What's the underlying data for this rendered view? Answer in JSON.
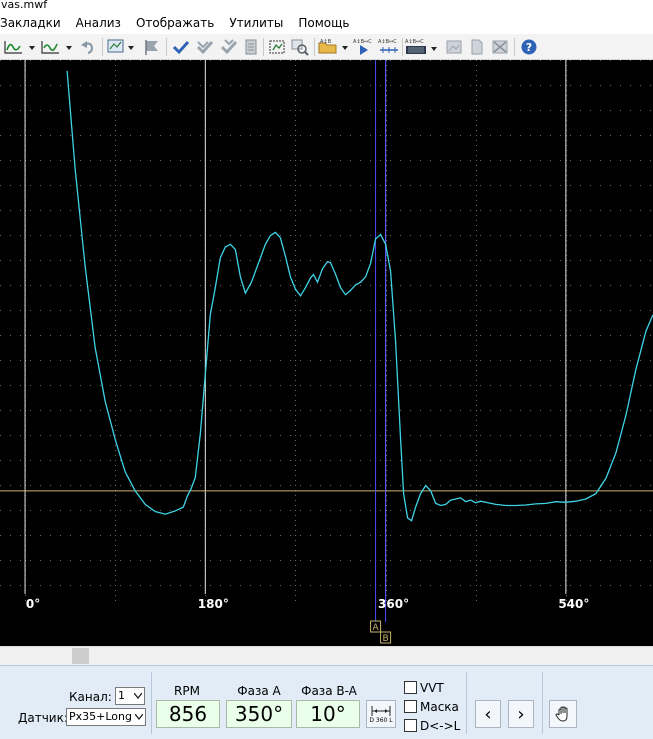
{
  "window": {
    "title": "vas.mwf"
  },
  "menu": [
    "Закладки",
    "Анализ",
    "Отображать",
    "Утилиты",
    "Помощь"
  ],
  "toolbar": {
    "icons": [
      "waveform-dropdown-icon",
      "waveform-dropdown-icon",
      "undo-icon",
      "screen-dropdown-icon",
      "flag-icon",
      "check-icon",
      "check-double-icon",
      "check-down-icon",
      "document-icon",
      "select-region-icon",
      "zoom-icon",
      "open-folder-dropdown-icon",
      "play-marker-icon",
      "ruler-marker-icon",
      "keyboard-dropdown-icon",
      "image-icon",
      "page-icon",
      "crossed-box-icon",
      "help-icon"
    ],
    "marker_tag": "A↕B↔C"
  },
  "scope": {
    "x_ticks": [
      "0°",
      "180°",
      "360°",
      "540°"
    ],
    "cursor_a_label": "A",
    "cursor_b_label": "B",
    "colors": {
      "trace": "#3fd3e6",
      "cursor": "#4b4bff",
      "threshold": "#c8b46e",
      "grid": "#6a6a6a",
      "bg": "#000000"
    }
  },
  "chart_data": {
    "type": "line",
    "x_unit": "degrees",
    "xlim": [
      -25,
      627
    ],
    "x_ticks": [
      0,
      180,
      360,
      540
    ],
    "cursor_a_deg": 350,
    "cursor_b_deg": 360,
    "series": [
      {
        "points": [
          [
            42,
            0.98
          ],
          [
            50,
            0.8
          ],
          [
            60,
            0.62
          ],
          [
            70,
            0.47
          ],
          [
            80,
            0.37
          ],
          [
            90,
            0.3
          ],
          [
            100,
            0.24
          ],
          [
            110,
            0.205
          ],
          [
            120,
            0.18
          ],
          [
            130,
            0.167
          ],
          [
            140,
            0.162
          ],
          [
            150,
            0.168
          ],
          [
            158,
            0.175
          ],
          [
            162,
            0.195
          ],
          [
            166,
            0.21
          ],
          [
            170,
            0.23
          ],
          [
            175,
            0.31
          ],
          [
            180,
            0.42
          ],
          [
            185,
            0.53
          ],
          [
            190,
            0.58
          ],
          [
            195,
            0.635
          ],
          [
            200,
            0.655
          ],
          [
            205,
            0.66
          ],
          [
            210,
            0.65
          ],
          [
            215,
            0.6
          ],
          [
            220,
            0.57
          ],
          [
            226,
            0.59
          ],
          [
            233,
            0.625
          ],
          [
            240,
            0.66
          ],
          [
            245,
            0.676
          ],
          [
            250,
            0.682
          ],
          [
            255,
            0.672
          ],
          [
            260,
            0.638
          ],
          [
            265,
            0.6
          ],
          [
            270,
            0.577
          ],
          [
            275,
            0.565
          ],
          [
            280,
            0.58
          ],
          [
            285,
            0.598
          ],
          [
            288,
            0.604
          ],
          [
            292,
            0.59
          ],
          [
            297,
            0.615
          ],
          [
            302,
            0.628
          ],
          [
            305,
            0.626
          ],
          [
            310,
            0.605
          ],
          [
            315,
            0.58
          ],
          [
            320,
            0.567
          ],
          [
            325,
            0.575
          ],
          [
            330,
            0.585
          ],
          [
            335,
            0.59
          ],
          [
            340,
            0.6
          ],
          [
            345,
            0.625
          ],
          [
            350,
            0.67
          ],
          [
            355,
            0.678
          ],
          [
            360,
            0.66
          ],
          [
            365,
            0.61
          ],
          [
            370,
            0.48
          ],
          [
            375,
            0.3
          ],
          [
            378,
            0.2
          ],
          [
            382,
            0.155
          ],
          [
            386,
            0.15
          ],
          [
            390,
            0.175
          ],
          [
            395,
            0.2
          ],
          [
            400,
            0.215
          ],
          [
            405,
            0.205
          ],
          [
            410,
            0.182
          ],
          [
            415,
            0.178
          ],
          [
            420,
            0.18
          ],
          [
            425,
            0.188
          ],
          [
            430,
            0.19
          ],
          [
            435,
            0.192
          ],
          [
            440,
            0.185
          ],
          [
            445,
            0.188
          ],
          [
            450,
            0.183
          ],
          [
            455,
            0.186
          ],
          [
            460,
            0.184
          ],
          [
            470,
            0.18
          ],
          [
            480,
            0.178
          ],
          [
            490,
            0.178
          ],
          [
            500,
            0.179
          ],
          [
            510,
            0.181
          ],
          [
            520,
            0.182
          ],
          [
            530,
            0.185
          ],
          [
            540,
            0.184
          ],
          [
            550,
            0.186
          ],
          [
            560,
            0.19
          ],
          [
            570,
            0.2
          ],
          [
            580,
            0.228
          ],
          [
            590,
            0.275
          ],
          [
            600,
            0.345
          ],
          [
            610,
            0.43
          ],
          [
            620,
            0.5
          ],
          [
            627,
            0.53
          ]
        ]
      }
    ],
    "threshold_level": 0.205
  },
  "controls": {
    "channel_label": "Канал:",
    "channel_value": "1",
    "sensor_label": "Датчик:",
    "sensor_value": "Px35+Long",
    "rpm_caption": "RPM",
    "rpm_value": "856",
    "phase_a_caption": "Фаза A",
    "phase_a_value": "350°",
    "phase_ba_caption": "Фаза B-A",
    "phase_ba_value": "10°",
    "d360_label": "D 360 L",
    "vvt_label": "VVT",
    "mask_label": "Маска",
    "dl_label": "D<->L",
    "prev_symbol": "‹",
    "next_symbol": "›"
  }
}
